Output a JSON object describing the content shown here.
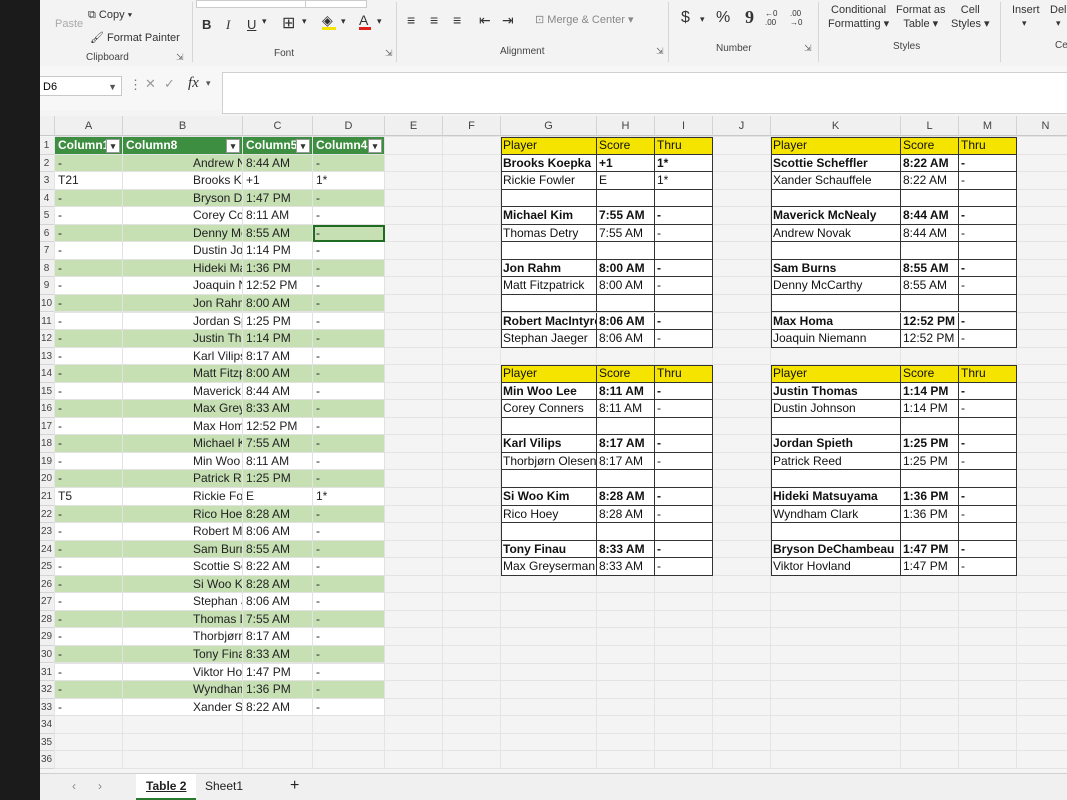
{
  "ribbon": {
    "clipboard": {
      "paste": "Paste",
      "copy": "Copy",
      "format_painter": "Format Painter",
      "group": "Clipboard"
    },
    "font": {
      "bold": "B",
      "italic": "I",
      "underline": "U",
      "group": "Font"
    },
    "alignment": {
      "merge": "Merge & Center",
      "group": "Alignment"
    },
    "number": {
      "currency": "$",
      "percent": "%",
      "comma": "9",
      "inc_decimal": "←0 .00",
      "dec_decimal": ".00 →0",
      "group": "Number"
    },
    "styles": {
      "conditional": "Conditional",
      "conditional2": "Formatting",
      "format_as": "Format as",
      "format_as2": "Table",
      "cell_styles": "Cell",
      "cell_styles2": "Styles",
      "group": "Styles"
    },
    "cells": {
      "insert": "Insert",
      "delete": "Del",
      "group": "Ce"
    }
  },
  "formula_bar": {
    "name_box": "D6",
    "fx": "fx",
    "value": ""
  },
  "columns": [
    "A",
    "B",
    "C",
    "D",
    "E",
    "F",
    "G",
    "H",
    "I",
    "J",
    "K",
    "L",
    "M",
    "N"
  ],
  "rows": [
    "1",
    "2",
    "3",
    "4",
    "5",
    "6",
    "7",
    "8",
    "9",
    "10",
    "11",
    "12",
    "13",
    "14",
    "15",
    "16",
    "17",
    "18",
    "19",
    "20",
    "21",
    "22",
    "23",
    "24",
    "25",
    "26",
    "27",
    "28",
    "29",
    "30",
    "31",
    "32",
    "33",
    "34",
    "35",
    "36"
  ],
  "table": {
    "headers": [
      "Column1",
      "Column8",
      "Column5",
      "Column4"
    ],
    "rows": [
      [
        "-",
        "Andrew Novak",
        "8:44 AM",
        "-"
      ],
      [
        "T21",
        "Brooks Koepka",
        "+1",
        "1*"
      ],
      [
        "-",
        "Bryson DeChambeau",
        "1:47 PM",
        "-"
      ],
      [
        "-",
        "Corey Conners",
        "8:11 AM",
        "-"
      ],
      [
        "-",
        "Denny McCarthy",
        "8:55 AM",
        "-"
      ],
      [
        "-",
        "Dustin Johnson",
        "1:14 PM",
        "-"
      ],
      [
        "-",
        "Hideki Matsuyama",
        "1:36 PM",
        "-"
      ],
      [
        "-",
        "Joaquin Niemann",
        "12:52 PM",
        "-"
      ],
      [
        "-",
        "Jon Rahm",
        "8:00 AM",
        "-"
      ],
      [
        "-",
        "Jordan Spieth",
        "1:25 PM",
        "-"
      ],
      [
        "-",
        "Justin Thomas",
        "1:14 PM",
        "-"
      ],
      [
        "-",
        "Karl Vilips",
        "8:17 AM",
        "-"
      ],
      [
        "-",
        "Matt Fitzpatrick",
        "8:00 AM",
        "-"
      ],
      [
        "-",
        "Maverick McNealy",
        "8:44 AM",
        "-"
      ],
      [
        "-",
        "Max Greyserman",
        "8:33 AM",
        "-"
      ],
      [
        "-",
        "Max Homa",
        "12:52 PM",
        "-"
      ],
      [
        "-",
        "Michael Kim",
        "7:55 AM",
        "-"
      ],
      [
        "-",
        "Min Woo Lee",
        "8:11 AM",
        "-"
      ],
      [
        "-",
        "Patrick Reed",
        "1:25 PM",
        "-"
      ],
      [
        "T5",
        "Rickie Fowler",
        "E",
        "1*"
      ],
      [
        "-",
        "Rico Hoey",
        "8:28 AM",
        "-"
      ],
      [
        "-",
        "Robert MacIntyre",
        "8:06 AM",
        "-"
      ],
      [
        "-",
        "Sam Burns",
        "8:55 AM",
        "-"
      ],
      [
        "-",
        "Scottie Scheffler",
        "8:22 AM",
        "-"
      ],
      [
        "-",
        "Si Woo Kim",
        "8:28 AM",
        "-"
      ],
      [
        "-",
        "Stephan Jaeger",
        "8:06 AM",
        "-"
      ],
      [
        "-",
        "Thomas Detry",
        "7:55 AM",
        "-"
      ],
      [
        "-",
        "Thorbjørn Olesen",
        "8:17 AM",
        "-"
      ],
      [
        "-",
        "Tony Finau",
        "8:33 AM",
        "-"
      ],
      [
        "-",
        "Viktor Hovland",
        "1:47 PM",
        "-"
      ],
      [
        "-",
        "Wyndham Clark",
        "1:36 PM",
        "-"
      ],
      [
        "-",
        "Xander Schauffele",
        "8:22 AM",
        "-"
      ]
    ]
  },
  "pairings": {
    "header": [
      "Player",
      "Score",
      "Thru"
    ],
    "ghi_top": [
      [
        [
          "Brooks Koepka",
          "+1",
          "1*"
        ],
        [
          "Rickie Fowler",
          "E",
          "1*"
        ]
      ],
      [
        [
          "Michael Kim",
          "7:55 AM",
          "-"
        ],
        [
          "Thomas Detry",
          "7:55 AM",
          "-"
        ]
      ],
      [
        [
          "Jon Rahm",
          "8:00 AM",
          "-"
        ],
        [
          "Matt Fitzpatrick",
          "8:00 AM",
          "-"
        ]
      ],
      [
        [
          "Robert MacIntyre",
          "8:06 AM",
          "-"
        ],
        [
          "Stephan Jaeger",
          "8:06 AM",
          "-"
        ]
      ]
    ],
    "ghi_bottom": [
      [
        [
          "Min Woo Lee",
          "8:11 AM",
          "-"
        ],
        [
          "Corey Conners",
          "8:11 AM",
          "-"
        ]
      ],
      [
        [
          "Karl Vilips",
          "8:17 AM",
          "-"
        ],
        [
          "Thorbjørn Olesen",
          "8:17 AM",
          "-"
        ]
      ],
      [
        [
          "Si Woo Kim",
          "8:28 AM",
          "-"
        ],
        [
          "Rico Hoey",
          "8:28 AM",
          "-"
        ]
      ],
      [
        [
          "Tony Finau",
          "8:33 AM",
          "-"
        ],
        [
          "Max Greyserman",
          "8:33 AM",
          "-"
        ]
      ]
    ],
    "klm_top": [
      [
        [
          "Scottie Scheffler",
          "8:22 AM",
          "-"
        ],
        [
          "Xander Schauffele",
          "8:22 AM",
          "-"
        ]
      ],
      [
        [
          "Maverick McNealy",
          "8:44 AM",
          "-"
        ],
        [
          "Andrew Novak",
          "8:44 AM",
          "-"
        ]
      ],
      [
        [
          "Sam Burns",
          "8:55 AM",
          "-"
        ],
        [
          "Denny McCarthy",
          "8:55 AM",
          "-"
        ]
      ],
      [
        [
          "Max Homa",
          "12:52 PM",
          "-"
        ],
        [
          "Joaquin Niemann",
          "12:52 PM",
          "-"
        ]
      ]
    ],
    "klm_bottom": [
      [
        [
          "Justin Thomas",
          "1:14 PM",
          "-"
        ],
        [
          "Dustin Johnson",
          "1:14 PM",
          "-"
        ]
      ],
      [
        [
          "Jordan Spieth",
          "1:25 PM",
          "-"
        ],
        [
          "Patrick Reed",
          "1:25 PM",
          "-"
        ]
      ],
      [
        [
          "Hideki Matsuyama",
          "1:36 PM",
          "-"
        ],
        [
          "Wyndham Clark",
          "1:36 PM",
          "-"
        ]
      ],
      [
        [
          "Bryson DeChambeau",
          "1:47 PM",
          "-"
        ],
        [
          "Viktor Hovland",
          "1:47 PM",
          "-"
        ]
      ]
    ]
  },
  "sheet_tabs": [
    "Table 2",
    "Sheet1"
  ],
  "add_sheet": "+",
  "colors": {
    "table_header": "#3e8e41",
    "table_band": "#c6e0b4",
    "pairing_header": "#f5e400"
  }
}
